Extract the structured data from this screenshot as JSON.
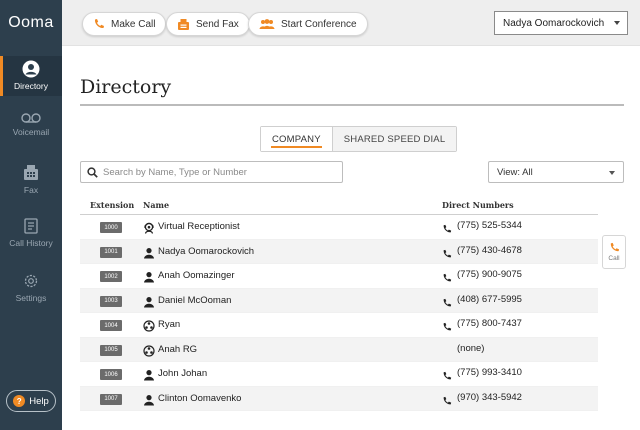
{
  "app": {
    "logo": "Ooma"
  },
  "sidebar": {
    "items": [
      {
        "label": "Directory",
        "icon": "user-circle-icon",
        "active": true
      },
      {
        "label": "Voicemail",
        "icon": "voicemail-icon",
        "active": false
      },
      {
        "label": "Fax",
        "icon": "fax-icon",
        "active": false
      },
      {
        "label": "Call History",
        "icon": "call-history-icon",
        "active": false
      },
      {
        "label": "Settings",
        "icon": "gear-icon",
        "active": false
      }
    ],
    "help_label": "Help"
  },
  "toolbar": {
    "make_call": "Make Call",
    "send_fax": "Send Fax",
    "start_conference": "Start Conference",
    "user_name": "Nadya Oomarockovich"
  },
  "main": {
    "title": "Directory",
    "tabs": [
      {
        "label": "COMPANY",
        "active": true
      },
      {
        "label": "SHARED SPEED DIAL",
        "active": false
      }
    ],
    "search_placeholder": "Search by Name, Type or Number",
    "view_label": "View: All",
    "columns": {
      "extension": "Extension",
      "name": "Name",
      "numbers": "Direct Numbers"
    },
    "rows": [
      {
        "ext": "1000",
        "name": "Virtual Receptionist",
        "type": "receptionist",
        "number": "(775) 525-5344"
      },
      {
        "ext": "1001",
        "name": "Nadya Oomarockovich",
        "type": "user",
        "number": "(775) 430-4678"
      },
      {
        "ext": "1002",
        "name": "Anah Oomazinger",
        "type": "user",
        "number": "(775) 900-9075"
      },
      {
        "ext": "1003",
        "name": "Daniel McOoman",
        "type": "user",
        "number": "(408) 677-5995"
      },
      {
        "ext": "1004",
        "name": "Ryan",
        "type": "group",
        "number": "(775) 800-7437"
      },
      {
        "ext": "1005",
        "name": "Anah RG",
        "type": "group",
        "number": "(none)"
      },
      {
        "ext": "1006",
        "name": "John Johan",
        "type": "user",
        "number": "(775) 993-3410"
      },
      {
        "ext": "1007",
        "name": "Clinton Oomavenko",
        "type": "user",
        "number": "(970) 343-5942"
      }
    ],
    "call_tab_label": "Call"
  },
  "colors": {
    "accent": "#f08a24",
    "sidebar": "#2d3f4d"
  }
}
